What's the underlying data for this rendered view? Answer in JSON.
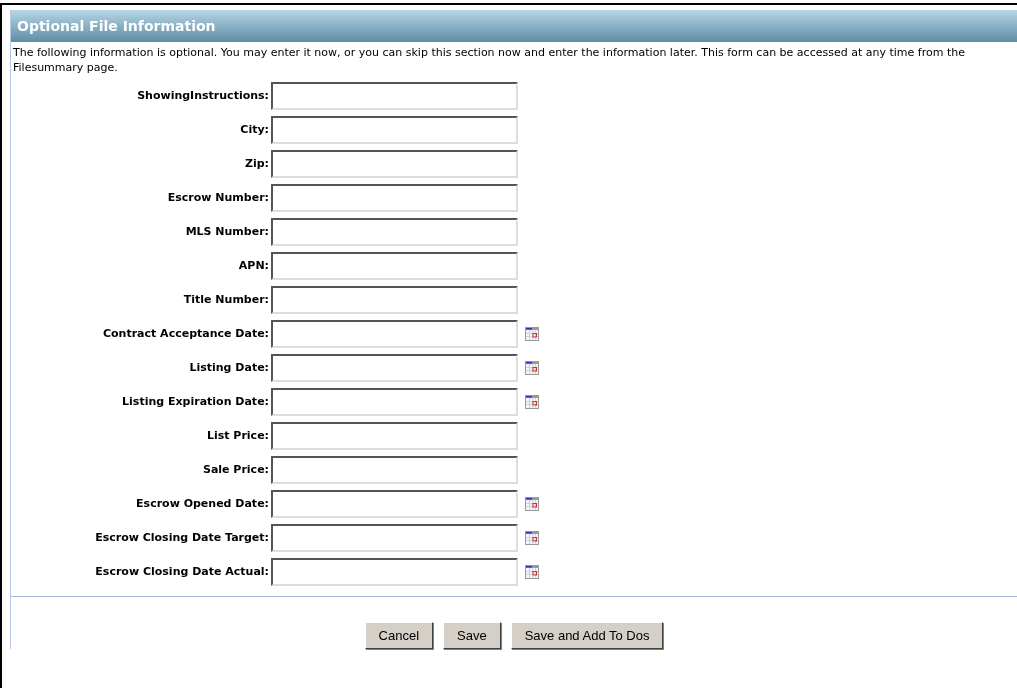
{
  "section": {
    "title": "Optional File Information",
    "description": "The following information is optional. You may enter it now, or you can skip this section now and enter the information later.  This form can be accessed at any time from the Filesummary page."
  },
  "fields": [
    {
      "label": "ShowingInstructions:",
      "kind": "text"
    },
    {
      "label": "City:",
      "kind": "text"
    },
    {
      "label": "Zip:",
      "kind": "text"
    },
    {
      "label": "Escrow Number:",
      "kind": "text"
    },
    {
      "label": "MLS Number:",
      "kind": "text"
    },
    {
      "label": "APN:",
      "kind": "text"
    },
    {
      "label": "Title Number:",
      "kind": "text"
    },
    {
      "label": "Contract Acceptance Date:",
      "kind": "date"
    },
    {
      "label": "Listing Date:",
      "kind": "date"
    },
    {
      "label": "Listing Expiration Date:",
      "kind": "date"
    },
    {
      "label": "List Price:",
      "kind": "text"
    },
    {
      "label": "Sale Price:",
      "kind": "text"
    },
    {
      "label": "Escrow Opened Date:",
      "kind": "date"
    },
    {
      "label": "Escrow Closing Date Target:",
      "kind": "date"
    },
    {
      "label": "Escrow Closing Date Actual:",
      "kind": "date"
    }
  ],
  "buttons": [
    "Cancel",
    "Save",
    "Save and Add To Dos"
  ]
}
